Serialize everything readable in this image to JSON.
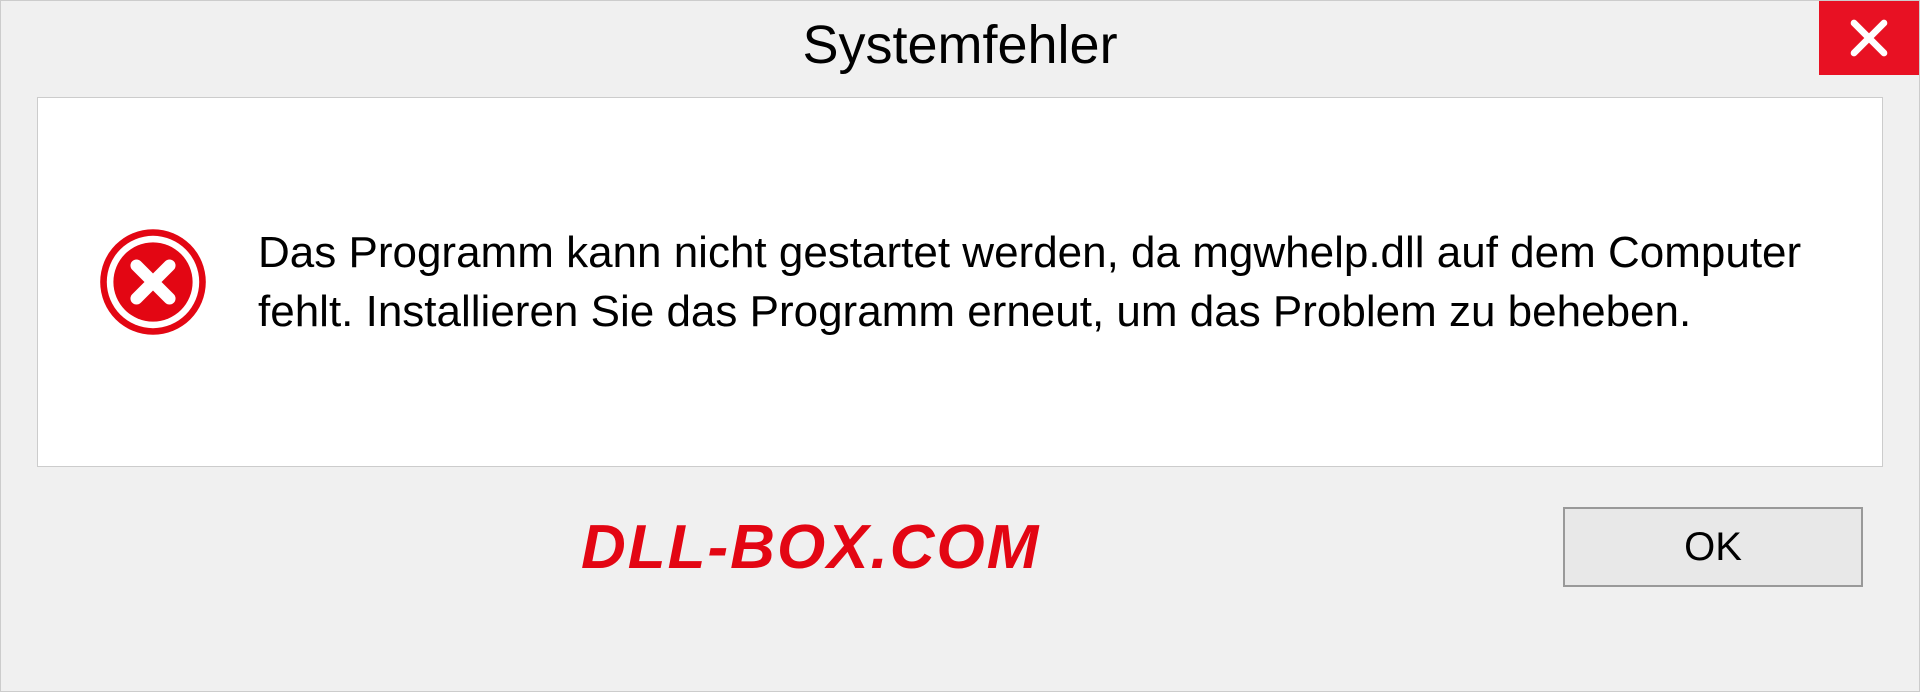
{
  "title": "Systemfehler",
  "message": "Das Programm kann nicht gestartet werden, da mgwhelp.dll auf dem Computer fehlt. Installieren Sie das Programm erneut, um das Problem zu beheben.",
  "watermark": "DLL-BOX.COM",
  "buttons": {
    "ok": "OK"
  }
}
